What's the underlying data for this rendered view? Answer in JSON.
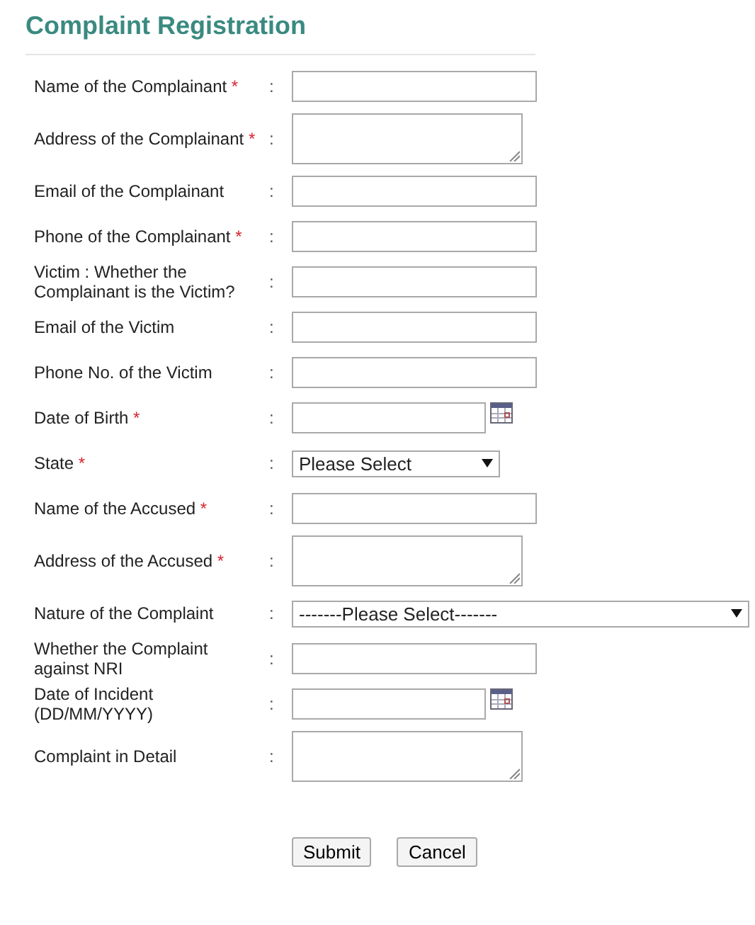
{
  "title": "Complaint Registration",
  "fields": [
    {
      "label": "Name of the Complainant",
      "required_mark": "*",
      "separator": ":",
      "kind": "text"
    },
    {
      "label": "Address of the Complainant",
      "required_mark": "*",
      "separator": ":",
      "kind": "textarea"
    },
    {
      "label": "Email of the Complainant",
      "separator": ":",
      "kind": "text"
    },
    {
      "label": "Phone of the Complainant",
      "required_mark": "*",
      "separator": ":",
      "kind": "text"
    },
    {
      "label": "Victim : Whether the Complainant is the Victim?",
      "separator": ":",
      "kind": "text"
    },
    {
      "label": "Email of the Victim",
      "separator": ":",
      "kind": "text"
    },
    {
      "label": "Phone No. of the Victim",
      "separator": ":",
      "kind": "text"
    },
    {
      "label": "Date of Birth",
      "required_mark": "*",
      "separator": ":",
      "kind": "date"
    },
    {
      "label": "State",
      "required_mark": "*",
      "separator": ":",
      "kind": "select",
      "value": "Please Select"
    },
    {
      "label": "Name of the Accused",
      "required_mark": "*",
      "separator": ":",
      "kind": "text"
    },
    {
      "label": "Address of the Accused",
      "required_mark": "*",
      "separator": ":",
      "kind": "textarea"
    },
    {
      "label": "Nature of the Complaint",
      "separator": ":",
      "kind": "select-wide",
      "value": "-------Please Select-------"
    },
    {
      "label": "Whether the Complaint against NRI",
      "separator": ":",
      "kind": "text"
    },
    {
      "label": "Date of Incident (DD/MM/YYYY)",
      "separator": ":",
      "kind": "date"
    },
    {
      "label": "Complaint in Detail",
      "separator": ":",
      "kind": "textarea"
    }
  ],
  "buttons": [
    "Submit",
    "Cancel"
  ]
}
